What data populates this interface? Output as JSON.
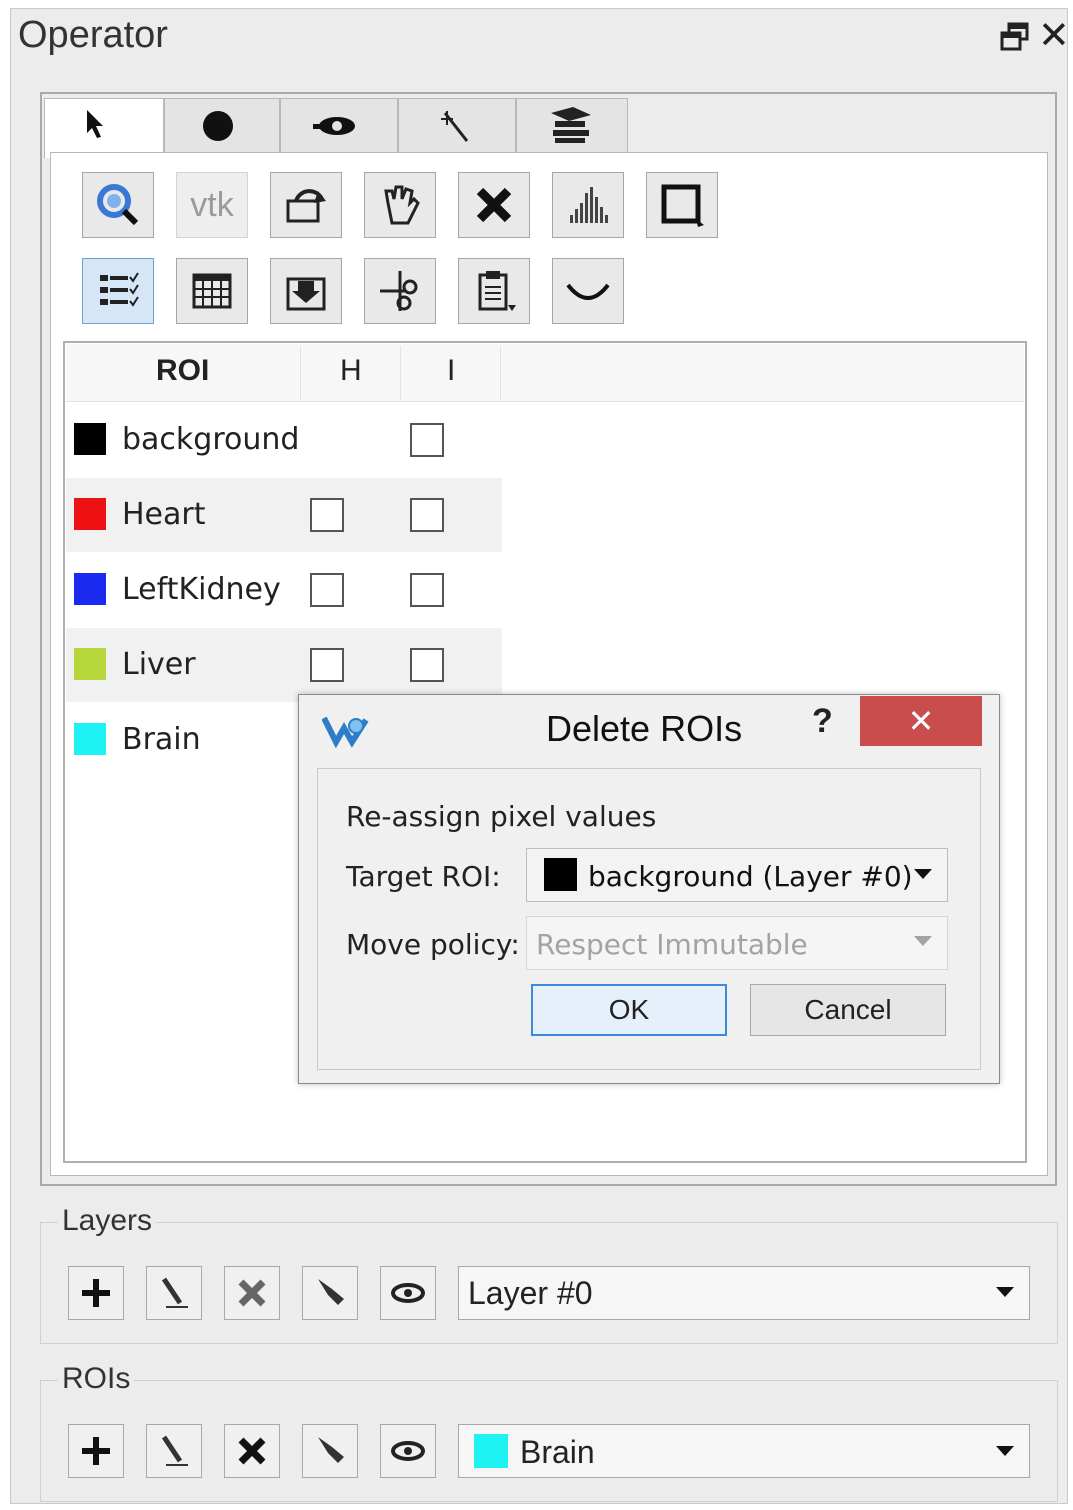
{
  "panel": {
    "title": "Operator",
    "float_icon": "float-window-icon",
    "close_glyph": "✕"
  },
  "tabs": [
    {
      "icon": "pointer-arrow-icon"
    },
    {
      "icon": "filled-circle-icon"
    },
    {
      "icon": "eye-brush-icon"
    },
    {
      "icon": "magic-wand-icon"
    },
    {
      "icon": "graduation-cap-icon"
    }
  ],
  "toolbar": {
    "row1": [
      "gradient-search-icon",
      "vtk-icon",
      "rotate-view-icon",
      "hand-icon",
      "delete-x-icon",
      "histogram-icon",
      "square-selection-icon"
    ],
    "row2": [
      "roi-list-icon",
      "table-grid-icon",
      "import-icon",
      "scissors-icon",
      "clipboard-paste-icon",
      "curve-icon"
    ],
    "vtk_text": "vtk"
  },
  "roi_table": {
    "headers": [
      "ROI",
      "H",
      "I"
    ],
    "rows": [
      {
        "name": "background",
        "color": "#000000",
        "has_h": false
      },
      {
        "name": "Heart",
        "color": "#ee1111",
        "has_h": true
      },
      {
        "name": "LeftKidney",
        "color": "#1a2aee",
        "has_h": true
      },
      {
        "name": "Liver",
        "color": "#b7d63a",
        "has_h": true
      },
      {
        "name": "Brain",
        "color": "#1ef2f2",
        "has_h": false
      }
    ]
  },
  "dialog": {
    "title": "Delete ROIs",
    "help": "?",
    "close_glyph": "✕",
    "section": "Re-assign pixel values",
    "target_label": "Target ROI:",
    "target_value": "background (Layer #0)",
    "target_color": "#000000",
    "move_label": "Move policy:",
    "move_value": "Respect Immutable",
    "ok": "OK",
    "cancel": "Cancel"
  },
  "layers": {
    "title": "Layers",
    "selected": "Layer #0",
    "buttons": [
      "add-icon",
      "edit-brush-icon",
      "delete-icon",
      "fill-bucket-icon",
      "visibility-eye-icon"
    ]
  },
  "rois": {
    "title": "ROIs",
    "selected": "Brain",
    "selected_color": "#1ef2f2",
    "buttons": [
      "add-icon",
      "edit-brush-icon",
      "delete-icon",
      "fill-bucket-icon",
      "visibility-eye-icon"
    ]
  }
}
